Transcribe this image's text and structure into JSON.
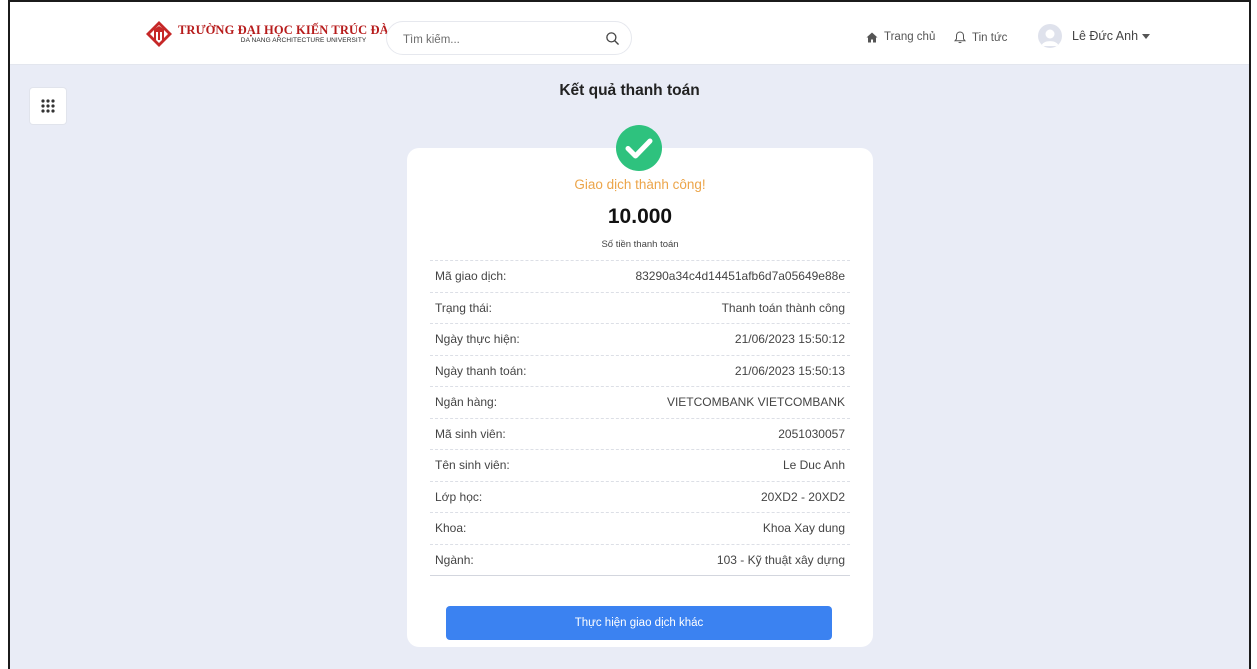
{
  "header": {
    "logo_title": "TRƯỜNG ĐẠI HỌC KIẾN TRÚC ĐÀ NẴNG",
    "logo_subtitle": "DA NANG ARCHITECTURE UNIVERSITY",
    "search_placeholder": "Tìm kiếm...",
    "nav": {
      "home": "Trang chủ",
      "news": "Tin tức"
    },
    "user_name": "Lê Đức Anh"
  },
  "page": {
    "title": "Kết quả thanh toán"
  },
  "result": {
    "message": "Giao dịch thành công!",
    "amount": "10.000",
    "amount_label": "Số tiền thanh toán",
    "details": [
      {
        "label": "Mã giao dịch:",
        "value": "83290a34c4d14451afb6d7a05649e88e"
      },
      {
        "label": "Trạng thái:",
        "value": "Thanh toán thành công"
      },
      {
        "label": "Ngày thực hiện:",
        "value": "21/06/2023 15:50:12"
      },
      {
        "label": "Ngày thanh toán:",
        "value": "21/06/2023 15:50:13"
      },
      {
        "label": "Ngân hàng:",
        "value": "VIETCOMBANK VIETCOMBANK"
      },
      {
        "label": "Mã sinh viên:",
        "value": "2051030057"
      },
      {
        "label": "Tên sinh viên:",
        "value": "Le Duc Anh"
      },
      {
        "label": "Lớp học:",
        "value": "20XD2 - 20XD2"
      },
      {
        "label": "Khoa:",
        "value": "Khoa Xay dung"
      },
      {
        "label": "Ngành:",
        "value": "103 - Kỹ thuật xây dựng"
      }
    ],
    "button_label": "Thực hiện giao dịch khác"
  },
  "colors": {
    "accent": "#3b82f1",
    "success": "#2ec27e",
    "success_text": "#eca54a",
    "brand": "#b71c1c",
    "background": "#e9ecf6"
  },
  "icons": [
    "university-logo",
    "search-icon",
    "home-icon",
    "bell-icon",
    "user-avatar-icon",
    "caret-down-icon",
    "apps-grid-icon",
    "check-circle-icon"
  ]
}
